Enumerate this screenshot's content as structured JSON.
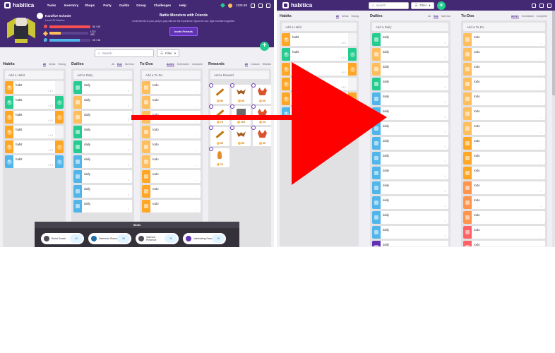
{
  "left": {
    "nav": {
      "logo": "habitica",
      "links": [
        "Tasks",
        "Inventory",
        "Shops",
        "Party",
        "Guilds",
        "Group",
        "Challenges",
        "Help"
      ],
      "gems": "",
      "gold": "1100.88"
    },
    "user": {
      "name": "Karafive Schmitt",
      "class": "Level 20 Warrior",
      "hp": "50 / 50",
      "xp": "133 / 452",
      "mp": "28 / 38",
      "hp_fraction": 1.0,
      "xp_fraction": 0.29,
      "mp_fraction": 0.74
    },
    "banner": {
      "title": "Battle Monsters with Friends",
      "text": "Invite friends to your party to play with the full experience! Quest for loot, fight monsters together!",
      "button": "Invite Friends"
    },
    "search_placeholder": "Search",
    "filter_label": "Filter",
    "habits": {
      "title": "Habits",
      "tabs": [
        "All",
        "Weak",
        "Strong"
      ],
      "add": "Add a Habit",
      "items": [
        {
          "text": "habit",
          "meta": "+ 1 0",
          "lcolor": "#ffa624",
          "rcolor": "#f4f4f6",
          "lsym": "+",
          "rsym": ""
        },
        {
          "text": "habit",
          "meta": "+ 1 0",
          "lcolor": "#24cc8f",
          "rcolor": "#24cc8f",
          "lsym": "+",
          "rsym": "-"
        },
        {
          "text": "habit",
          "meta": "+ 1 0",
          "lcolor": "#ffa624",
          "rcolor": "#ffa624",
          "lsym": "+",
          "rsym": "-"
        },
        {
          "text": "habit",
          "meta": "+ 1 0",
          "lcolor": "#ffa624",
          "rcolor": "#f4f4f6",
          "lsym": "+",
          "rsym": ""
        },
        {
          "text": "habit",
          "meta": "+ 1 0",
          "lcolor": "#ffa624",
          "rcolor": "#ffa624",
          "lsym": "+",
          "rsym": "-"
        },
        {
          "text": "habit",
          "meta": "+ 1 0",
          "lcolor": "#50b5e9",
          "rcolor": "#50b5e9",
          "lsym": "+",
          "rsym": "-"
        }
      ]
    },
    "dailies": {
      "title": "Dailies",
      "tabs": [
        "All",
        "Due",
        "Not Due"
      ],
      "add": "Add a Daily",
      "items": [
        {
          "text": "daily",
          "meta": "1",
          "color": "#24cc8f"
        },
        {
          "text": "daily",
          "meta": "1",
          "color": "#ffbe5d"
        },
        {
          "text": "daily",
          "meta": "1",
          "color": "#ffbe5d"
        },
        {
          "text": "daily",
          "meta": "1",
          "color": "#24cc8f"
        },
        {
          "text": "daily",
          "meta": "1",
          "color": "#24cc8f"
        },
        {
          "text": "daily",
          "meta": "1",
          "color": "#50b5e9"
        },
        {
          "text": "daily",
          "meta": "1",
          "color": "#50b5e9"
        },
        {
          "text": "daily",
          "meta": "1",
          "color": "#50b5e9"
        },
        {
          "text": "daily",
          "meta": "1",
          "color": "#50b5e9"
        }
      ]
    },
    "todos": {
      "title": "To-Dos",
      "tabs": [
        "Active",
        "Scheduled",
        "Complete"
      ],
      "add": "Add a To-Do",
      "items": [
        {
          "text": "todo",
          "color": "#ffbe5d"
        },
        {
          "text": "todo",
          "color": "#ffbe5d"
        },
        {
          "text": "todo",
          "color": "#ffbe5d"
        },
        {
          "text": "todo",
          "color": "#ffbe5d"
        },
        {
          "text": "todo",
          "color": "#ffbe5d"
        },
        {
          "text": "todo",
          "color": "#ffbe5d"
        },
        {
          "text": "todo",
          "color": "#ffa624"
        },
        {
          "text": "todo",
          "color": "#ffa624"
        },
        {
          "text": "todo",
          "color": "#ffa624"
        }
      ]
    },
    "rewards": {
      "title": "Rewards",
      "tabs": [
        "All",
        "Custom",
        "Wishlist"
      ],
      "add": "Add a Reward",
      "items": [
        {
          "price": "90",
          "art": "sword"
        },
        {
          "price": "50",
          "art": "bat"
        },
        {
          "price": "60",
          "art": "crab"
        },
        {
          "price": "70",
          "art": "sword2"
        },
        {
          "price": "101",
          "art": "box"
        },
        {
          "price": "23",
          "art": "crab"
        },
        {
          "price": "90",
          "art": "sword"
        },
        {
          "price": "50",
          "art": "bat"
        },
        {
          "price": "60",
          "art": "crab"
        },
        {
          "price": "70",
          "art": "potion"
        }
      ]
    },
    "skills": {
      "title": "Skills",
      "items": [
        {
          "name": "Brutal Smash",
          "cost": "10"
        },
        {
          "name": "Defensive Stance",
          "cost": "25"
        },
        {
          "name": "Valorous Presence",
          "cost": "20"
        },
        {
          "name": "Intimidating Gaze",
          "cost": "15"
        }
      ]
    }
  },
  "right": {
    "nav": {
      "logo": "habitica",
      "search_placeholder": "search",
      "filter_label": "Filter"
    },
    "habits": {
      "title": "Habits",
      "tabs": [
        "All",
        "Weak",
        "Strong"
      ],
      "add": "Add a Habit",
      "items": [
        {
          "text": "habit",
          "meta": "+ 1 0",
          "lcolor": "#ffa624",
          "rcolor": "#f4f4f6",
          "lsym": "+",
          "rsym": ""
        },
        {
          "text": "habit",
          "meta": "+ 1 0",
          "lcolor": "#24cc8f",
          "rcolor": "#24cc8f",
          "lsym": "+",
          "rsym": "-"
        },
        {
          "text": "habit",
          "meta": "+ 1 0",
          "lcolor": "#ffa624",
          "rcolor": "#ffa624",
          "lsym": "+",
          "rsym": "-"
        },
        {
          "text": "habit",
          "meta": "+ 1 0",
          "lcolor": "#ffa624",
          "rcolor": "#f4f4f6",
          "lsym": "+",
          "rsym": ""
        },
        {
          "text": "habit",
          "meta": "+ 1 0",
          "lcolor": "#ffa624",
          "rcolor": "#ffa624",
          "lsym": "+",
          "rsym": "-"
        },
        {
          "text": "habit",
          "meta": "+ 1 0",
          "lcolor": "#50b5e9",
          "rcolor": "#50b5e9",
          "lsym": "+",
          "rsym": "-"
        }
      ]
    },
    "dailies": {
      "title": "Dailies",
      "tabs": [
        "All",
        "Due",
        "Not Due"
      ],
      "add": "Add a Daily",
      "items": [
        {
          "text": "daily",
          "meta": "1",
          "color": "#24cc8f"
        },
        {
          "text": "daily",
          "meta": "1",
          "color": "#ffbe5d"
        },
        {
          "text": "daily",
          "meta": "1",
          "color": "#ffbe5d"
        },
        {
          "text": "daily",
          "meta": "1",
          "color": "#24cc8f"
        },
        {
          "text": "daily",
          "meta": "1",
          "color": "#50b5e9"
        },
        {
          "text": "daily",
          "meta": "1",
          "color": "#50b5e9"
        },
        {
          "text": "daily",
          "meta": "1",
          "color": "#50b5e9"
        },
        {
          "text": "daily",
          "meta": "1",
          "color": "#50b5e9"
        },
        {
          "text": "daily",
          "meta": "1",
          "color": "#50b5e9"
        },
        {
          "text": "daily",
          "meta": "1",
          "color": "#50b5e9"
        },
        {
          "text": "daily",
          "meta": "1",
          "color": "#50b5e9"
        },
        {
          "text": "daily",
          "meta": "1",
          "color": "#50b5e9"
        },
        {
          "text": "daily",
          "meta": "1",
          "color": "#50b5e9"
        },
        {
          "text": "daily",
          "meta": "1",
          "color": "#50b5e9"
        },
        {
          "text": "daily",
          "meta": "1",
          "color": "#6133b4"
        },
        {
          "text": "daily",
          "meta": "1",
          "color": "#50b5e9"
        }
      ]
    },
    "todos": {
      "title": "To-Dos",
      "tabs": [
        "Active",
        "Scheduled",
        "Complete"
      ],
      "add": "Add a To-Do",
      "items": [
        {
          "text": "todo",
          "color": "#ffbe5d"
        },
        {
          "text": "todo",
          "color": "#ffbe5d"
        },
        {
          "text": "todo",
          "color": "#ffbe5d"
        },
        {
          "text": "todo",
          "color": "#ffbe5d"
        },
        {
          "text": "todo",
          "color": "#ffbe5d"
        },
        {
          "text": "todo",
          "color": "#ffbe5d"
        },
        {
          "text": "todo",
          "color": "#ffbe5d"
        },
        {
          "text": "todo",
          "color": "#ffa624"
        },
        {
          "text": "todo",
          "color": "#ffa624"
        },
        {
          "text": "todo",
          "color": "#ffa624"
        },
        {
          "text": "todo",
          "color": "#ff944c"
        },
        {
          "text": "todo",
          "color": "#ff944c"
        },
        {
          "text": "todo",
          "color": "#ff944c"
        },
        {
          "text": "todo",
          "color": "#ff6165"
        },
        {
          "text": "todo",
          "color": "#ff6165"
        },
        {
          "text": "todo",
          "color": "#ff6165"
        },
        {
          "text": "todo",
          "color": "#ff6165"
        }
      ]
    }
  },
  "colors": {
    "nav": "#432874",
    "green": "#24cc8f",
    "arrow": "#ff0000"
  }
}
